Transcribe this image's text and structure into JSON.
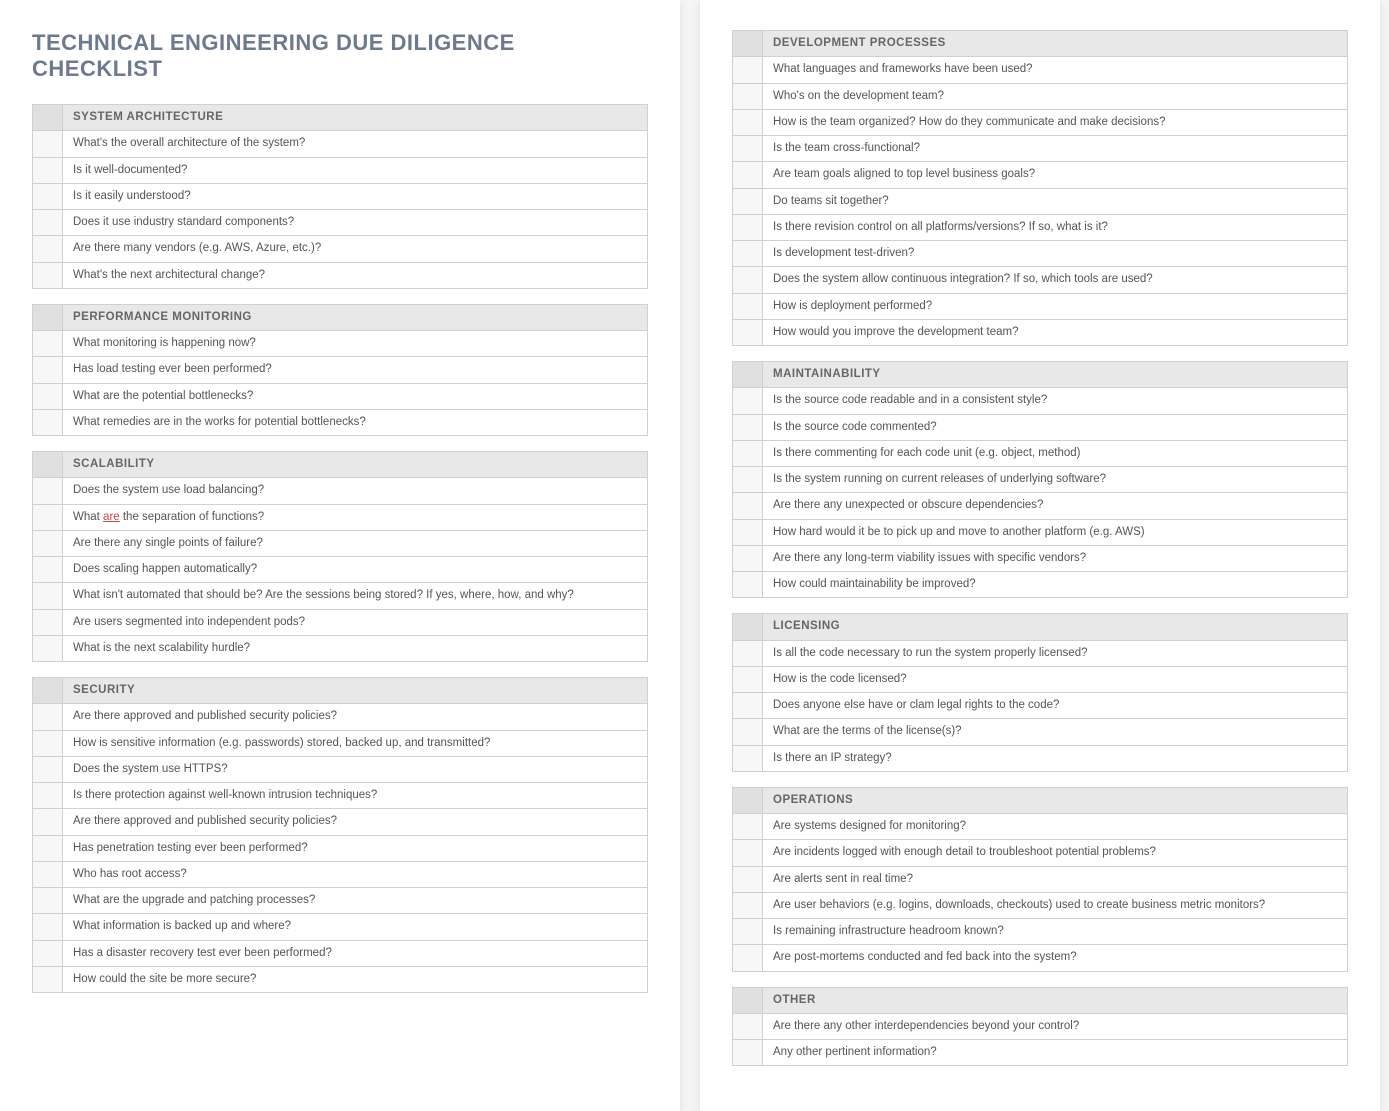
{
  "title": "TECHNICAL ENGINEERING DUE DILIGENCE CHECKLIST",
  "left_sections": [
    {
      "header": "SYSTEM ARCHITECTURE",
      "items": [
        "What's the overall architecture of the system?",
        "Is it well-documented?",
        "Is it easily understood?",
        "Does it use industry standard components?",
        "Are there many vendors (e.g. AWS, Azure, etc.)?",
        "What's the next architectural change?"
      ]
    },
    {
      "header": "PERFORMANCE MONITORING",
      "items": [
        "What monitoring is happening now?",
        "Has load testing ever been performed?",
        "What are the potential bottlenecks?",
        "What remedies are in the works for potential bottlenecks?"
      ]
    },
    {
      "header": "SCALABILITY",
      "items": [
        "Does the system use load balancing?",
        {
          "pre": "What ",
          "u": "are",
          "post": " the separation of functions?"
        },
        "Are there any single points of failure?",
        "Does scaling happen automatically?",
        "What isn't automated that should be? Are the sessions being stored? If yes, where, how, and why?",
        "Are users segmented into independent pods?",
        "What is the next scalability hurdle?"
      ]
    },
    {
      "header": "SECURITY",
      "items": [
        "Are there approved and published security policies?",
        "How is sensitive information (e.g. passwords) stored, backed up, and transmitted?",
        "Does the system use HTTPS?",
        "Is there protection against well-known intrusion techniques?",
        "Are there approved and published security policies?",
        "Has penetration testing ever been performed?",
        "Who has root access?",
        "What are the upgrade and patching processes?",
        "What information is backed up and where?",
        "Has a disaster recovery test ever been performed?",
        "How could the site be more secure?"
      ]
    }
  ],
  "right_sections": [
    {
      "header": "DEVELOPMENT PROCESSES",
      "items": [
        "What languages and frameworks have been used?",
        "Who's on the development team?",
        "How is the team organized? How do they communicate and make decisions?",
        "Is the team cross-functional?",
        "Are team goals aligned to top level business goals?",
        "Do teams sit together?",
        "Is there revision control on all platforms/versions? If so, what is it?",
        "Is development test-driven?",
        "Does the system allow continuous integration? If so, which tools are used?",
        "How is deployment performed?",
        "How would you improve the development team?"
      ]
    },
    {
      "header": "MAINTAINABILITY",
      "items": [
        "Is the source code readable and in a consistent style?",
        "Is the source code commented?",
        "Is there commenting for each code unit (e.g. object, method)",
        "Is the system running on current releases of underlying software?",
        "Are there any unexpected or obscure dependencies?",
        "How hard would it be to pick up and move to another platform (e.g. AWS)",
        "Are there any long-term viability issues with specific vendors?",
        "How could maintainability be improved?"
      ]
    },
    {
      "header": "LICENSING",
      "items": [
        "Is all the code necessary to run the system properly licensed?",
        "How is the code licensed?",
        "Does anyone else have or clam legal rights to the code?",
        "What are the terms of the license(s)?",
        "Is there an IP strategy?"
      ]
    },
    {
      "header": "OPERATIONS",
      "items": [
        "Are systems designed for monitoring?",
        "Are incidents logged with enough detail to troubleshoot potential problems?",
        "Are alerts sent in real time?",
        "Are user behaviors (e.g. logins, downloads, checkouts) used to create business metric monitors?",
        "Is remaining infrastructure headroom known?",
        "Are post-mortems conducted and fed back into the system?"
      ]
    },
    {
      "header": "OTHER",
      "items": [
        "Are there any other interdependencies beyond your control?",
        "Any other pertinent information?"
      ]
    }
  ]
}
